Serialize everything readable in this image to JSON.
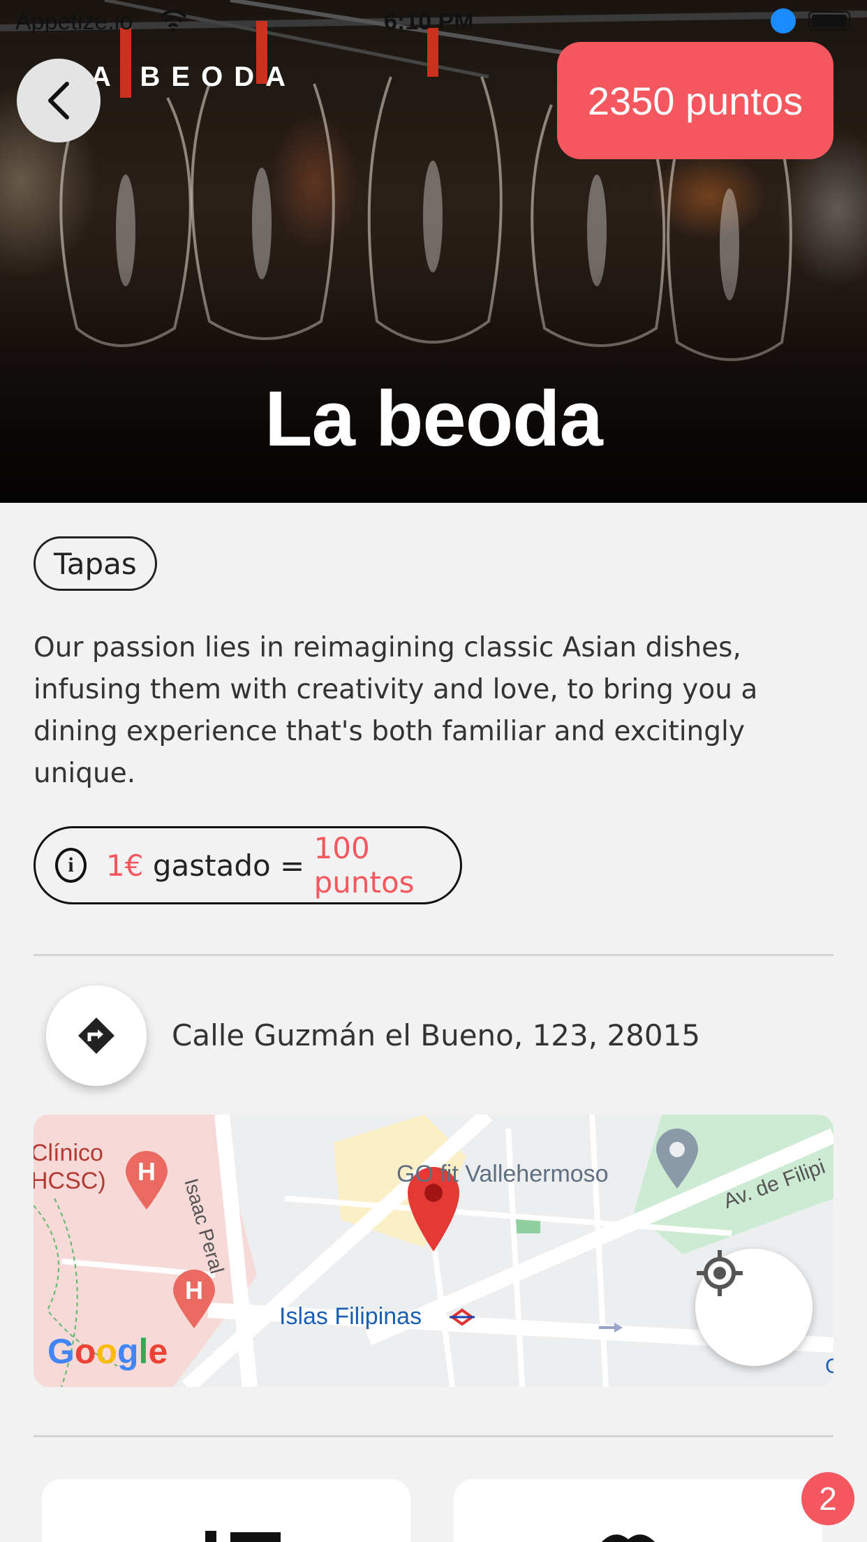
{
  "status_bar": {
    "carrier": "Appetize.io",
    "time": "6:10 PM"
  },
  "hero": {
    "brand_logo": "A BEODA",
    "title": "La beoda"
  },
  "header": {
    "points_badge": "2350 puntos"
  },
  "restaurant": {
    "tag": "Tapas",
    "description": "Our passion lies in reimagining classic Asian dishes, infusing them with creativity and love, to bring you a dining experience that's both familiar and excitingly unique.",
    "rate": {
      "amount": "1€",
      "middle": " gastado = ",
      "points": "100 puntos"
    },
    "address": "Calle Guzmán el Bueno, 123, 28015"
  },
  "map": {
    "labels": {
      "clinico": "Clínico",
      "hcsc": "HCSC)",
      "street": "Isaac Peral",
      "gofit": "GO fit Vallehermoso",
      "avenue": "Av. de Filipi",
      "metro": "Islas Filipinas"
    },
    "google_logo": "Google",
    "attribution_partial": "G"
  },
  "notifications": {
    "count": "2"
  },
  "colors": {
    "accent": "#f5575e",
    "background": "#f2f2f2"
  }
}
